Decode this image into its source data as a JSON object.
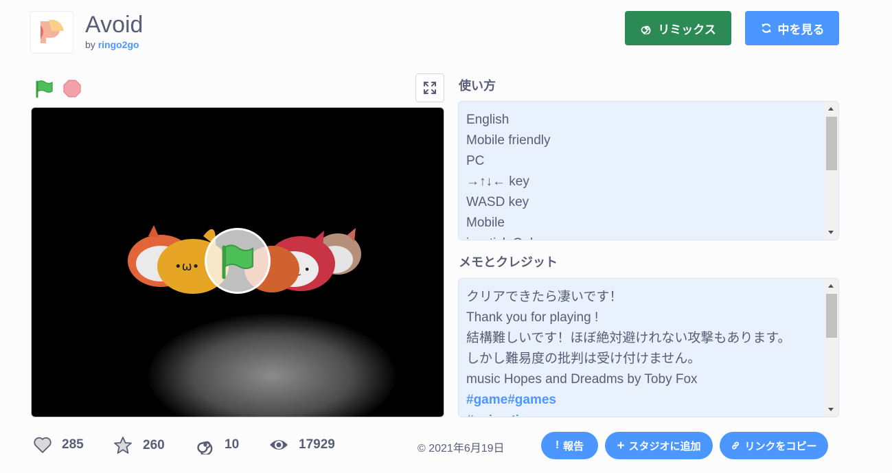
{
  "header": {
    "title": "Avoid",
    "by_prefix": "by",
    "author": "ringo2go",
    "remix_label": "リミックス",
    "see_inside_label": "中を見る"
  },
  "player": {
    "green_flag": "green-flag-icon",
    "stop": "stop-icon",
    "fullscreen": "fullscreen-icon"
  },
  "instructions": {
    "title": "使い方",
    "lines": [
      "English",
      "Mobile friendly",
      "PC",
      "→↑↓← key",
      "WASD key",
      "Mobile",
      "joystick Only"
    ]
  },
  "notes": {
    "title": "メモとクレジット",
    "lines": [
      "クリアできたら凄いです！",
      "Thank you for playing !",
      "結構難しいです！ほぼ絶対避けれない攻撃もあります。",
      "しかし難易度の批判は受け付けません。",
      "music Hopes and Dreadms by Toby Fox"
    ],
    "tags": [
      "#game#games",
      "#animations"
    ]
  },
  "stats": {
    "loves": "285",
    "favorites": "260",
    "remixes": "10",
    "views": "17929"
  },
  "footer": {
    "date": "© 2021年6月19日",
    "report_label": "報告",
    "add_studio_label": "スタジオに追加",
    "copy_link_label": "リンクをコピー"
  },
  "colors": {
    "remix": "#2c8b55",
    "primary": "#4c97ff",
    "panel_bg": "#e9f1fc",
    "text": "#575e75"
  }
}
